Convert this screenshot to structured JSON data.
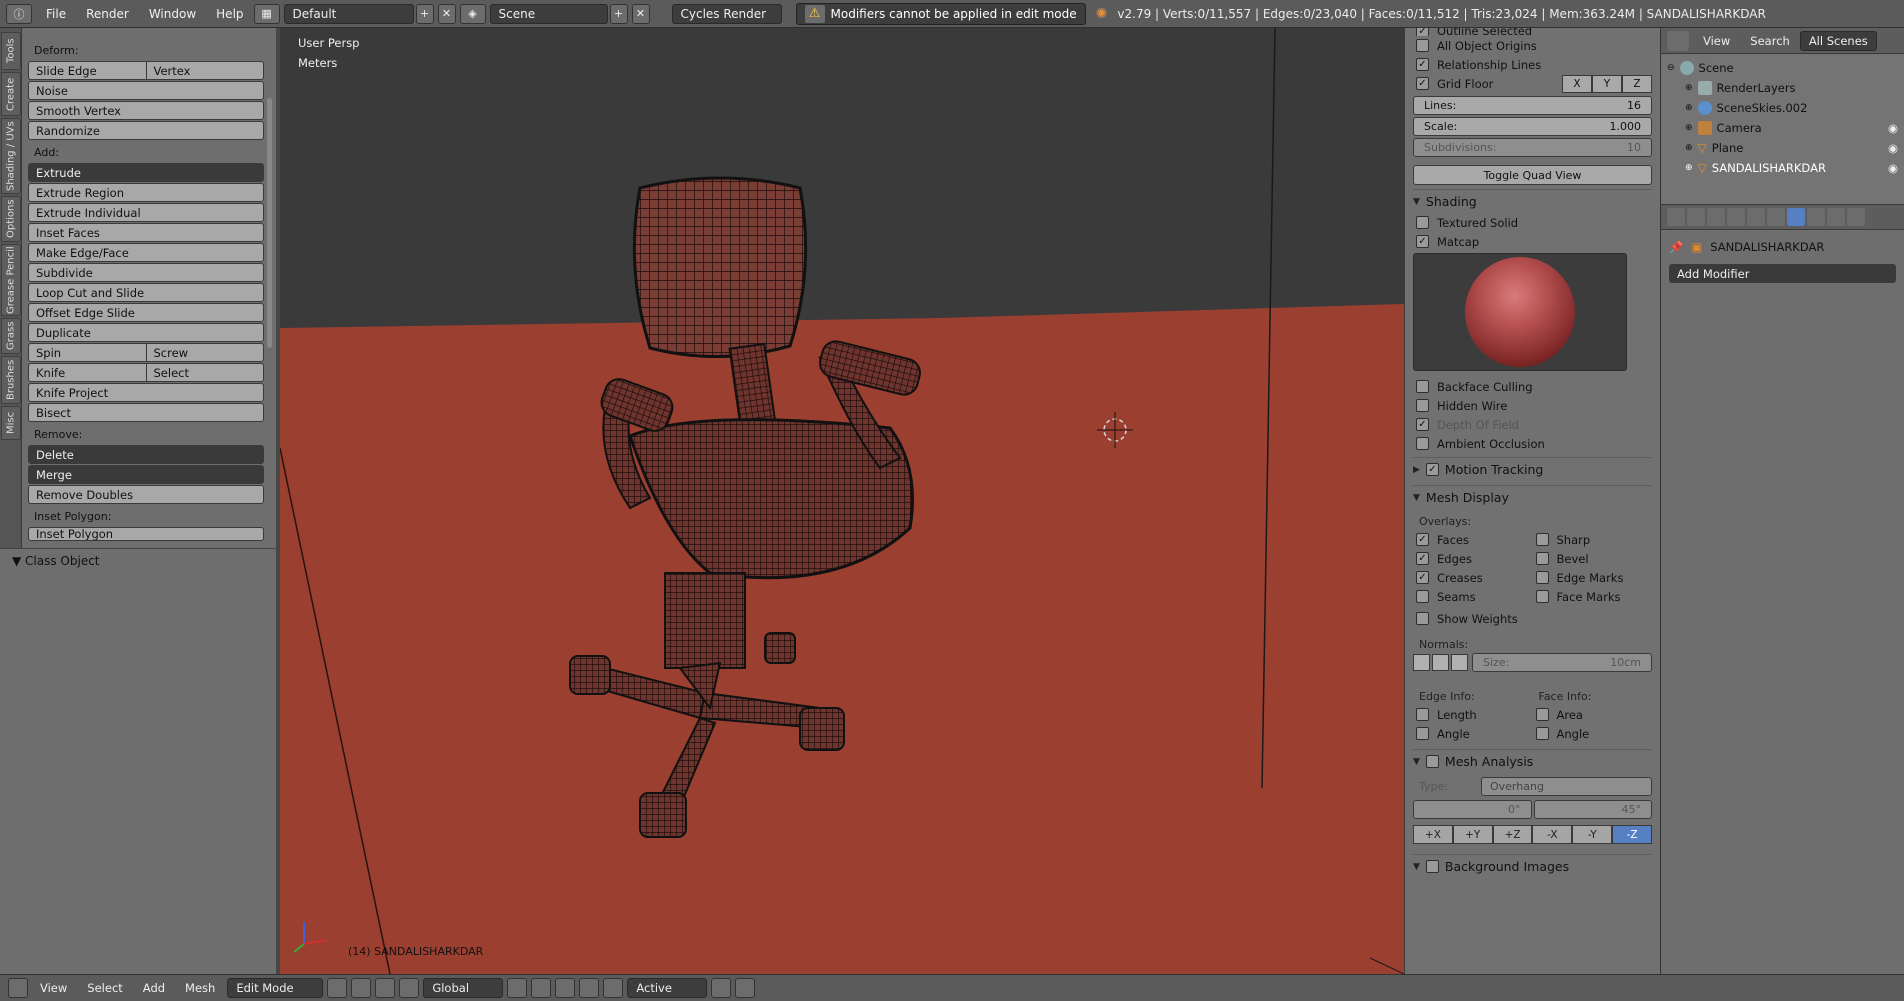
{
  "top": {
    "menus": [
      "File",
      "Render",
      "Window",
      "Help"
    ],
    "layout": "Default",
    "scene": "Scene",
    "engine": "Cycles Render",
    "warning": "Modifiers cannot be applied in edit mode",
    "stats": "v2.79 | Verts:0/11,557 | Edges:0/23,040 | Faces:0/11,512 | Tris:23,024 | Mem:363.24M | SANDALISHARKDAR"
  },
  "tabs": [
    "Tools",
    "Create",
    "Shading / UVs",
    "Options",
    "Grease Pencil",
    "Grass",
    "Brushes",
    "Misc"
  ],
  "tools": {
    "deform_header": "Deform:",
    "slide_edge": "Slide Edge",
    "vertex": "Vertex",
    "noise": "Noise",
    "smooth_vertex": "Smooth Vertex",
    "randomize": "Randomize",
    "add_header": "Add:",
    "extrude": "Extrude",
    "extrude_region": "Extrude Region",
    "extrude_individual": "Extrude Individual",
    "inset_faces": "Inset Faces",
    "make_edge_face": "Make Edge/Face",
    "subdivide": "Subdivide",
    "loop_cut": "Loop Cut and Slide",
    "offset_edge": "Offset Edge Slide",
    "duplicate": "Duplicate",
    "spin": "Spin",
    "screw": "Screw",
    "knife": "Knife",
    "select": "Select",
    "knife_project": "Knife Project",
    "bisect": "Bisect",
    "remove_header": "Remove:",
    "delete": "Delete",
    "merge": "Merge",
    "remove_doubles": "Remove Doubles",
    "inset_header": "Inset Polygon:",
    "inset_polygon": "Inset Polygon",
    "class_object": "Class Object"
  },
  "viewport": {
    "persp": "User Persp",
    "units": "Meters",
    "object_label": "(14) SANDALISHARKDAR"
  },
  "npanel": {
    "outline_selected": "Outline Selected",
    "all_origins": "All Object Origins",
    "relationship_lines": "Relationship Lines",
    "grid_floor": "Grid Floor",
    "axes": [
      "X",
      "Y",
      "Z"
    ],
    "lines_label": "Lines:",
    "lines_value": "16",
    "scale_label": "Scale:",
    "scale_value": "1.000",
    "subdiv_label": "Subdivisions:",
    "subdiv_value": "10",
    "toggle_quad": "Toggle Quad View",
    "shading": "Shading",
    "textured_solid": "Textured Solid",
    "matcap": "Matcap",
    "backface": "Backface Culling",
    "hidden_wire": "Hidden Wire",
    "dof": "Depth Of Field",
    "ao": "Ambient Occlusion",
    "motion_tracking": "Motion Tracking",
    "mesh_display": "Mesh Display",
    "overlays": "Overlays:",
    "faces": "Faces",
    "sharp": "Sharp",
    "edges": "Edges",
    "bevel": "Bevel",
    "creases": "Creases",
    "edge_marks": "Edge Marks",
    "seams": "Seams",
    "face_marks": "Face Marks",
    "show_weights": "Show Weights",
    "normals": "Normals:",
    "size_label": "Size:",
    "size_value": "10cm",
    "edge_info": "Edge Info:",
    "face_info": "Face Info:",
    "length": "Length",
    "area": "Area",
    "angle": "Angle",
    "mesh_analysis": "Mesh Analysis",
    "type_label": "Type:",
    "type_value": "Overhang",
    "min_angle": "0°",
    "max_angle": "45°",
    "axis_buttons": [
      "+X",
      "+Y",
      "+Z",
      "-X",
      "-Y",
      "-Z"
    ],
    "background_images": "Background Images"
  },
  "outliner": {
    "view": "View",
    "search": "Search",
    "filter": "All Scenes",
    "items": [
      "Scene",
      "RenderLayers",
      "SceneSkies.002",
      "Camera",
      "Plane",
      "SANDALISHARKDAR"
    ]
  },
  "properties": {
    "object": "SANDALISHARKDAR",
    "add_modifier": "Add Modifier"
  },
  "bottom": {
    "menus": [
      "View",
      "Select",
      "Add",
      "Mesh"
    ],
    "mode": "Edit Mode",
    "orientation": "Global",
    "pivot": "Active"
  }
}
